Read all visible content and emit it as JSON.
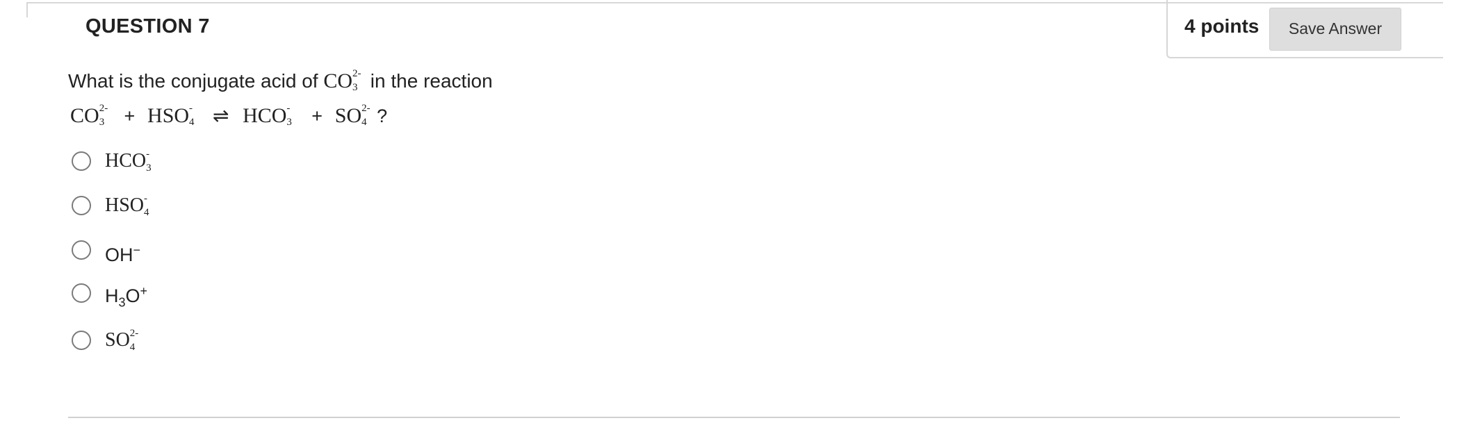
{
  "question": {
    "title": "QUESTION 7",
    "points": "4 points",
    "save_label": "Save Answer",
    "prompt_before": "What is the conjugate acid of ",
    "prompt_species": "CO",
    "prompt_species_sup": "2-",
    "prompt_species_sub": "3",
    "prompt_after": " in the reaction",
    "reaction": {
      "r1": "CO",
      "r1_sup": "2-",
      "r1_sub": "3",
      "plus1": "+",
      "r2": "HSO",
      "r2_sup": "-",
      "r2_sub": "4",
      "arrow": "⇌",
      "p1": "HCO",
      "p1_sup": "-",
      "p1_sub": "3",
      "plus2": "+",
      "p2": "SO",
      "p2_sup": "2-",
      "p2_sub": "4",
      "end": "?"
    }
  },
  "options": [
    {
      "text": "HCO",
      "sup": "-",
      "sub": "3"
    },
    {
      "text": "HSO",
      "sup": "-",
      "sub": "4"
    },
    {
      "text": "OH",
      "sup": "−"
    },
    {
      "text_a": "H",
      "sub": "3",
      "text_b": "O",
      "sup": "+"
    },
    {
      "text": "SO",
      "sup": "2-",
      "sub": "4"
    }
  ]
}
